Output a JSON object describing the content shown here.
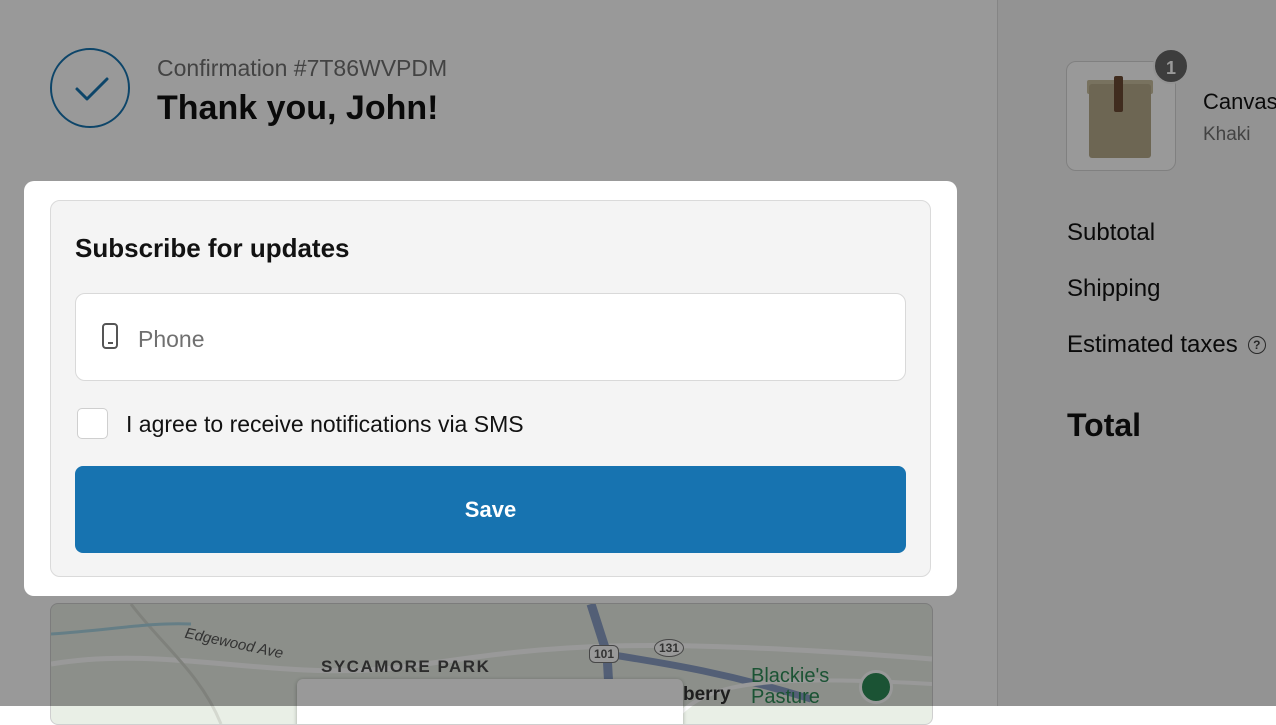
{
  "header": {
    "confirmation": "Confirmation #7T86WVPDM",
    "title": "Thank you, John!"
  },
  "subscribe": {
    "title": "Subscribe for updates",
    "phone_placeholder": "Phone",
    "phone_value": "",
    "sms_checked": false,
    "sms_label": "I agree to receive notifications via SMS",
    "save_label": "Save"
  },
  "map": {
    "street": "Edgewood Ave",
    "area": "SYCAMORE PARK",
    "route_101": "101",
    "route_131": "131",
    "place_line1": "Blackie's",
    "place_line2": "Pasture",
    "cut_text": "berry"
  },
  "summary": {
    "item": {
      "name": "Canvas",
      "variant": "Khaki",
      "quantity": "1"
    },
    "subtotal_label": "Subtotal",
    "shipping_label": "Shipping",
    "taxes_label": "Estimated taxes",
    "total_label": "Total"
  },
  "colors": {
    "accent": "#1773b0",
    "overlay": "rgba(0,0,0,0.4)",
    "card_bg": "#f4f4f4"
  }
}
